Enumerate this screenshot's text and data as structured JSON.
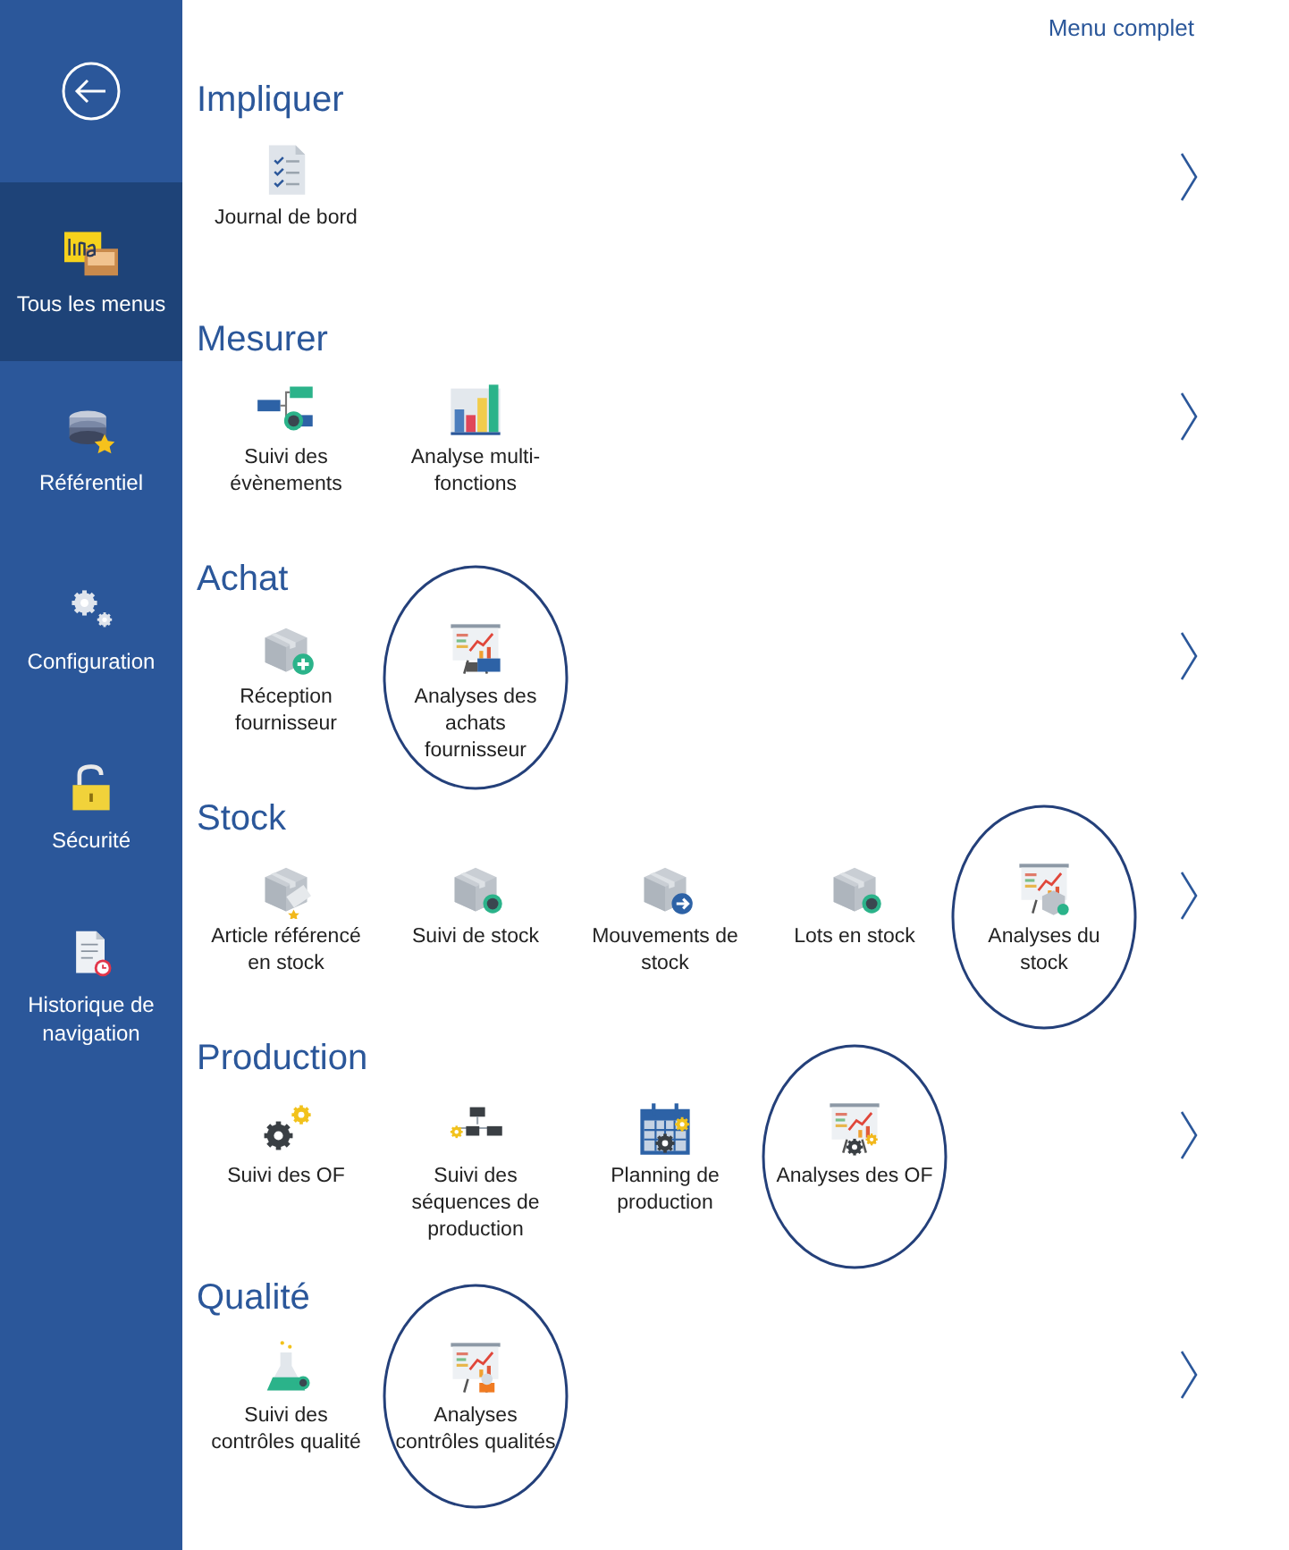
{
  "sidebar": {
    "items": [
      {
        "kind": "logo",
        "label": "Tous les menus",
        "selected": true
      },
      {
        "kind": "database",
        "label": "Référentiel",
        "selected": false
      },
      {
        "kind": "gears",
        "label": "Configuration",
        "selected": false
      },
      {
        "kind": "lock",
        "label": "Sécurité",
        "selected": false
      },
      {
        "kind": "history",
        "label": "Historique de navigation",
        "selected": false
      }
    ]
  },
  "header": {
    "link": "Menu complet"
  },
  "sections": [
    {
      "title": "Impliquer",
      "tiles": [
        {
          "kind": "checklist",
          "label": "Journal de bord",
          "highlighted": false
        }
      ]
    },
    {
      "title": "Mesurer",
      "tiles": [
        {
          "kind": "flow",
          "label": "Suivi des évènements",
          "highlighted": false
        },
        {
          "kind": "bars",
          "label": "Analyse multi-fonctions",
          "highlighted": false
        }
      ]
    },
    {
      "title": "Achat",
      "tiles": [
        {
          "kind": "box-plus",
          "label": "Réception fournisseur",
          "highlighted": false
        },
        {
          "kind": "board-truck",
          "label": "Analyses des achats fournisseur",
          "highlighted": true
        }
      ]
    },
    {
      "title": "Stock",
      "tiles": [
        {
          "kind": "box-tag",
          "label": "Article référencé en stock",
          "highlighted": false
        },
        {
          "kind": "box-eye",
          "label": "Suivi de stock",
          "highlighted": false
        },
        {
          "kind": "box-arrow",
          "label": "Mouvements de stock",
          "highlighted": false
        },
        {
          "kind": "box-eye",
          "label": "Lots en stock",
          "highlighted": false
        },
        {
          "kind": "board-box",
          "label": "Analyses du stock",
          "highlighted": true
        }
      ]
    },
    {
      "title": "Production",
      "tiles": [
        {
          "kind": "gears",
          "label": "Suivi des OF",
          "highlighted": false
        },
        {
          "kind": "sequence",
          "label": "Suivi des séquences de production",
          "highlighted": false
        },
        {
          "kind": "calendar",
          "label": "Planning de production",
          "highlighted": false
        },
        {
          "kind": "board-gear",
          "label": "Analyses des OF",
          "highlighted": true
        }
      ]
    },
    {
      "title": "Qualité",
      "tiles": [
        {
          "kind": "flask",
          "label": "Suivi des contrôles qualité",
          "highlighted": false
        },
        {
          "kind": "board-flask",
          "label": "Analyses contrôles qualités",
          "highlighted": true
        }
      ]
    }
  ]
}
